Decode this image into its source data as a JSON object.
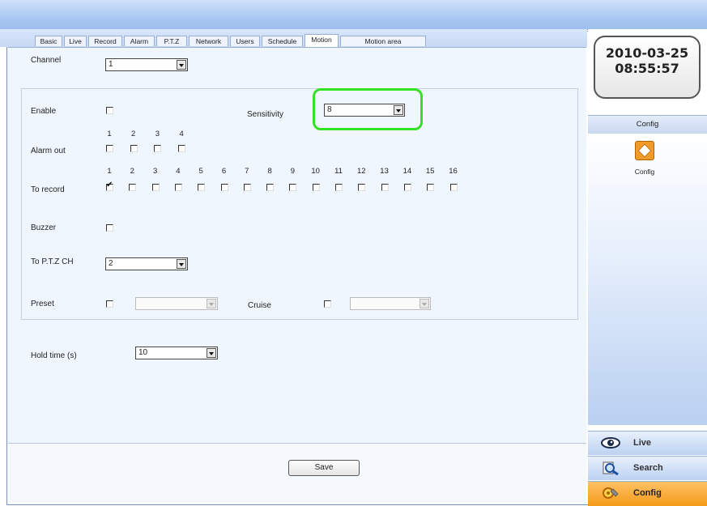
{
  "tabs": [
    "Basic",
    "Live",
    "Record",
    "Alarm",
    "P.T.Z",
    "Network",
    "Users",
    "Schedule",
    "Motion",
    "Motion area"
  ],
  "active_tab": "Motion",
  "form": {
    "channel_label": "Channel",
    "channel_value": "1",
    "enable_label": "Enable",
    "enable_checked": false,
    "sensitivity_label": "Sensitivity",
    "sensitivity_value": "8",
    "alarm_out_label": "Alarm out",
    "alarm_out_numbers": [
      "1",
      "2",
      "3",
      "4"
    ],
    "to_record_label": "To record",
    "to_record_numbers": [
      "1",
      "2",
      "3",
      "4",
      "5",
      "6",
      "7",
      "8",
      "9",
      "10",
      "11",
      "12",
      "13",
      "14",
      "15",
      "16"
    ],
    "to_record_checked": [
      1
    ],
    "buzzer_label": "Buzzer",
    "to_ptz_label": "To P.T.Z CH",
    "to_ptz_value": "2",
    "preset_label": "Preset",
    "cruise_label": "Cruise",
    "hold_time_label": "Hold time (s)",
    "hold_time_value": "10",
    "save_label": "Save"
  },
  "clock": {
    "date": "2010-03-25",
    "time": "08:55:57"
  },
  "side": {
    "config_header": "Config",
    "config_icon_label": "Config",
    "nav": [
      {
        "label": "Live",
        "icon": "eye-icon"
      },
      {
        "label": "Search",
        "icon": "search-icon"
      },
      {
        "label": "Config",
        "icon": "config-icon"
      }
    ]
  },
  "colors": {
    "highlight": "#33e224",
    "active_nav": "#f39a18",
    "accent_blue": "#a9c8f1"
  }
}
